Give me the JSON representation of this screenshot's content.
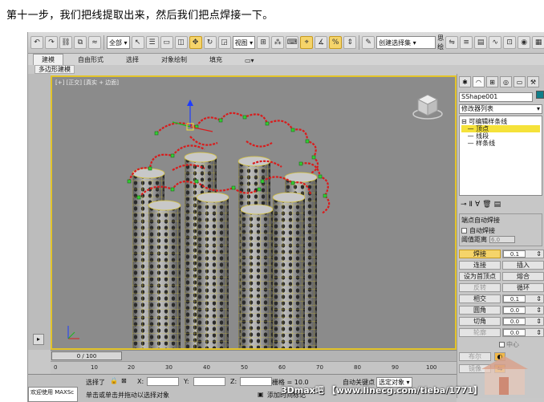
{
  "caption": "第十一步，我们把线提取出来，然后我们把点焊接一下。",
  "toolbar": {
    "filter_select": "全部",
    "view_select": "视图",
    "named_selection": "创建选择集",
    "named_selection_alt": "思绘"
  },
  "ribbon": {
    "tabs": [
      "建模",
      "自由形式",
      "选择",
      "对象绘制",
      "填充"
    ],
    "subtab": "多边形建模"
  },
  "viewport": {
    "label": "[+] [正交] [真实 + 边面]"
  },
  "command_panel": {
    "object_name": "SShape001",
    "modifier_list": "修改器列表",
    "stack": {
      "root": "可编辑样条线",
      "items": [
        "顶点",
        "线段",
        "样条线"
      ]
    },
    "auto_weld": {
      "title": "端点自动焊接",
      "checkbox": "自动焊接",
      "threshold_label": "阈值距离",
      "threshold_value": "6.0"
    },
    "buttons": [
      {
        "left": "焊接",
        "right": "0.1",
        "left_hl": true
      },
      {
        "left": "连接",
        "right": "插入"
      },
      {
        "left": "设为首顶点",
        "right": "熔合"
      },
      {
        "left": "反转",
        "right": "循环",
        "left_dis": true
      },
      {
        "left": "相交",
        "right": "0.1"
      },
      {
        "left": "圆角",
        "right": "0.0"
      },
      {
        "left": "切角",
        "right": "0.0"
      },
      {
        "left": "轮廓",
        "right": "0.0"
      }
    ],
    "center_check": "中心",
    "boolean_label": "布尔",
    "mirror_label": "镜像"
  },
  "timeline": {
    "slider": "0 / 100",
    "ticks": [
      "0",
      "10",
      "20",
      "30",
      "40",
      "50",
      "60",
      "70",
      "80",
      "90",
      "100"
    ]
  },
  "status": {
    "selected": "选择了",
    "x_label": "X:",
    "y_label": "Y:",
    "z_label": "Z:",
    "grid": "栅格 = 10.0",
    "autokey": "自动关键点",
    "set_key": "选定对象",
    "prompt": "单击或单击并拖动以选择对象",
    "add_time_tag": "添加时间标记"
  },
  "maxscript": "欢迎使用 MAXSc",
  "watermark": "3Dmax吧  【www.linecg.com/tieba/1771】"
}
